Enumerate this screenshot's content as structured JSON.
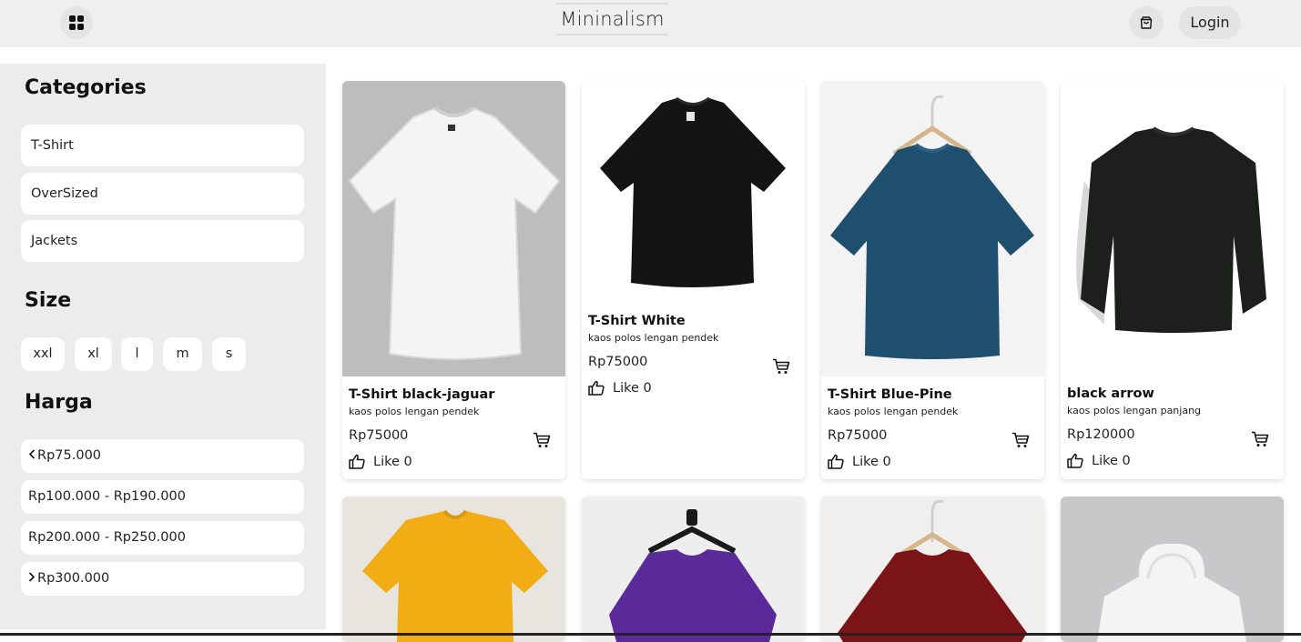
{
  "header": {
    "brand": "Mininalism",
    "login_label": "Login",
    "menu_icon": "grid-icon",
    "cart_icon": "shopping-bag-icon"
  },
  "sidebar": {
    "categories_title": "Categories",
    "categories": [
      "T-Shirt",
      "OverSized",
      "Jackets"
    ],
    "size_title": "Size",
    "sizes": [
      "xxl",
      "xl",
      "l",
      "m",
      "s"
    ],
    "price_title": "Harga",
    "prices": [
      {
        "label": "Rp75.000",
        "icon": "chevron-left-icon"
      },
      {
        "label": "Rp100.000 - Rp190.000",
        "icon": ""
      },
      {
        "label": "Rp200.000 - Rp250.000",
        "icon": ""
      },
      {
        "label": "Rp300.000",
        "icon": "chevron-right-icon"
      }
    ]
  },
  "products": [
    {
      "title": "T-Shirt black-jaguar",
      "desc": "kaos polos lengan pendek",
      "price": "Rp75000",
      "like": "Like 0",
      "color": "#f2f2f2",
      "bg": "#bdbdbd",
      "kind": "tee"
    },
    {
      "title": "T-Shirt White",
      "desc": "kaos polos lengan pendek",
      "price": "Rp75000",
      "like": "Like 0",
      "color": "#111111",
      "bg": "#ffffff",
      "kind": "tee"
    },
    {
      "title": "T-Shirt Blue-Pine",
      "desc": "kaos polos lengan pendek",
      "price": "Rp75000",
      "like": "Like 0",
      "color": "#1f4f6e",
      "bg": "#f3f3f3",
      "kind": "tee-hanger"
    },
    {
      "title": "black arrow",
      "desc": "kaos polos lengan panjang",
      "price": "Rp120000",
      "like": "Like 0",
      "color": "#1c1f1c",
      "bg": "#ffffff",
      "kind": "sweater"
    },
    {
      "color": "#f2ac14",
      "bg": "#e8e4de",
      "kind": "tee"
    },
    {
      "color": "#5b2a9a",
      "bg": "#eeeeee",
      "kind": "tee-hanger-black"
    },
    {
      "color": "#7a1416",
      "bg": "#f0efed",
      "kind": "tee-hanger"
    },
    {
      "color": "#f4f4f4",
      "bg": "#c8c7c9",
      "kind": "hoodie"
    }
  ]
}
